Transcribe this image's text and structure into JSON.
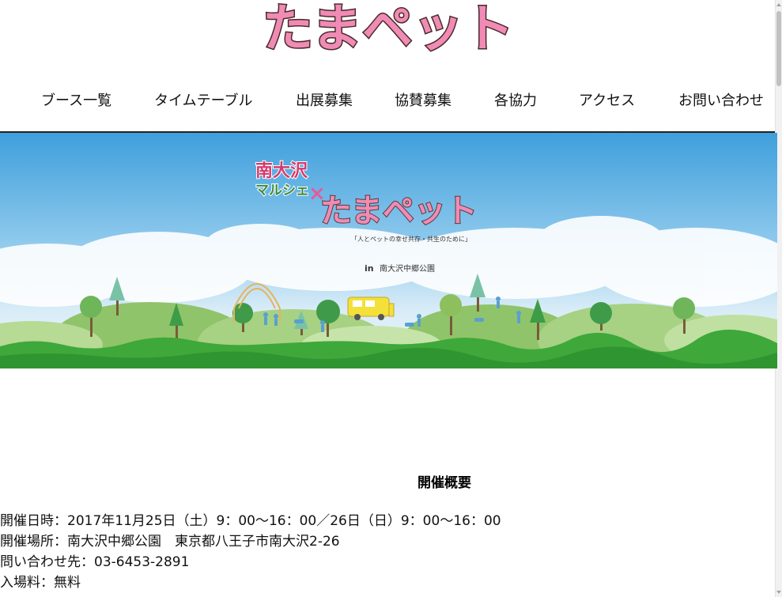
{
  "header": {
    "logo_text": "たまペット"
  },
  "nav": {
    "items": [
      {
        "label": "ブース一覧"
      },
      {
        "label": "タイムテーブル"
      },
      {
        "label": "出展募集"
      },
      {
        "label": "協賛募集"
      },
      {
        "label": "各協力"
      },
      {
        "label": "アクセス"
      },
      {
        "label": "お問い合わせ"
      }
    ]
  },
  "hero": {
    "brand_line1": "南大沢",
    "brand_line2": "マルシェ",
    "cross": "×",
    "event_logo": "たまペット",
    "tagline": "「人とペットの幸せ共存・共生のために」",
    "location_icon": "location-pin-icon",
    "location": "南大沢中郷公園",
    "colors": {
      "sky_top": "#4aa7df",
      "grass": "#3ea83a",
      "hill_light": "#9dcc74",
      "logo_pink": "#f08bb5",
      "logo_yellow": "#f3e03a"
    }
  },
  "overview": {
    "title": "開催概要",
    "lines": [
      "開催日時：2017年11月25日（土）9：00〜16：00／26日（日）9：00〜16：00",
      "開催場所：南大沢中郷公園　東京都八王子市南大沢2-26",
      "問い合わせ先：03-6453-2891",
      "入場料：無料"
    ]
  }
}
